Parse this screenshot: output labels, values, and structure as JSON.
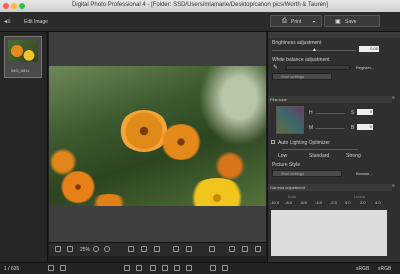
{
  "window": {
    "title": "Digital Photo Professional 4 - [Folder: SSD/Users/mlamarie/Desktop/canon pics/Worth & Tauren]"
  },
  "toolbar": {
    "edit_label": "Edit Image",
    "print_label": "Print",
    "save_label": "Save"
  },
  "filmstrip": {
    "thumb_name": "IMG_0811"
  },
  "viewer": {
    "zoom": "25%"
  },
  "panel": {
    "brightness": {
      "label": "Brightness adjustment",
      "value": "0.00"
    },
    "white_balance": {
      "label": "White balance adjustment",
      "register": "Register...",
      "dd": "Shot settings"
    },
    "finetune": {
      "header": "Fine-tune",
      "h_label": "H",
      "s_label": "S",
      "m_label": "M",
      "b_label": "B",
      "h_val": "0",
      "s_val": "0"
    },
    "alo": {
      "label": "Auto Lighting Optimizer",
      "levels": [
        "Low",
        "Standard",
        "Strong"
      ]
    },
    "picture_style": {
      "label": "Picture Style",
      "value": "Shot settings",
      "browse": "Browse..."
    },
    "gamma": {
      "header": "Gamma adjustment",
      "auto": "Auto",
      "linear": "Linear",
      "ticks": [
        "-10.0",
        "-8.0",
        "-6.0",
        "-4.0",
        "-2.0",
        "0.0",
        "2.0",
        "4.0"
      ]
    }
  },
  "status": {
    "count": "1 / 635",
    "color1": "sRGB",
    "color2": "sRGB"
  }
}
